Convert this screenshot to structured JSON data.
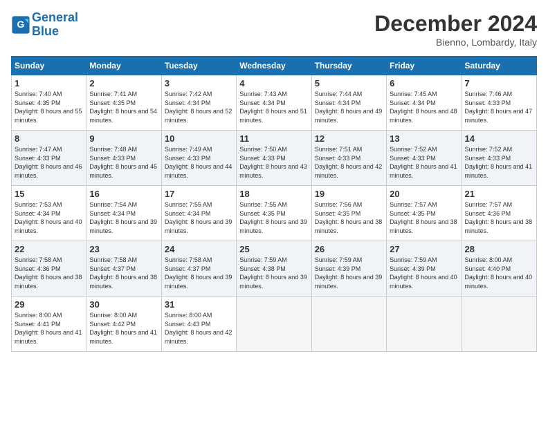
{
  "header": {
    "logo_line1": "General",
    "logo_line2": "Blue",
    "month": "December 2024",
    "location": "Bienno, Lombardy, Italy"
  },
  "days_of_week": [
    "Sunday",
    "Monday",
    "Tuesday",
    "Wednesday",
    "Thursday",
    "Friday",
    "Saturday"
  ],
  "weeks": [
    [
      {
        "day": "1",
        "rise": "7:40 AM",
        "set": "4:35 PM",
        "daylight": "8 hours and 55 minutes."
      },
      {
        "day": "2",
        "rise": "7:41 AM",
        "set": "4:35 PM",
        "daylight": "8 hours and 54 minutes."
      },
      {
        "day": "3",
        "rise": "7:42 AM",
        "set": "4:34 PM",
        "daylight": "8 hours and 52 minutes."
      },
      {
        "day": "4",
        "rise": "7:43 AM",
        "set": "4:34 PM",
        "daylight": "8 hours and 51 minutes."
      },
      {
        "day": "5",
        "rise": "7:44 AM",
        "set": "4:34 PM",
        "daylight": "8 hours and 49 minutes."
      },
      {
        "day": "6",
        "rise": "7:45 AM",
        "set": "4:34 PM",
        "daylight": "8 hours and 48 minutes."
      },
      {
        "day": "7",
        "rise": "7:46 AM",
        "set": "4:33 PM",
        "daylight": "8 hours and 47 minutes."
      }
    ],
    [
      {
        "day": "8",
        "rise": "7:47 AM",
        "set": "4:33 PM",
        "daylight": "8 hours and 46 minutes."
      },
      {
        "day": "9",
        "rise": "7:48 AM",
        "set": "4:33 PM",
        "daylight": "8 hours and 45 minutes."
      },
      {
        "day": "10",
        "rise": "7:49 AM",
        "set": "4:33 PM",
        "daylight": "8 hours and 44 minutes."
      },
      {
        "day": "11",
        "rise": "7:50 AM",
        "set": "4:33 PM",
        "daylight": "8 hours and 43 minutes."
      },
      {
        "day": "12",
        "rise": "7:51 AM",
        "set": "4:33 PM",
        "daylight": "8 hours and 42 minutes."
      },
      {
        "day": "13",
        "rise": "7:52 AM",
        "set": "4:33 PM",
        "daylight": "8 hours and 41 minutes."
      },
      {
        "day": "14",
        "rise": "7:52 AM",
        "set": "4:33 PM",
        "daylight": "8 hours and 41 minutes."
      }
    ],
    [
      {
        "day": "15",
        "rise": "7:53 AM",
        "set": "4:34 PM",
        "daylight": "8 hours and 40 minutes."
      },
      {
        "day": "16",
        "rise": "7:54 AM",
        "set": "4:34 PM",
        "daylight": "8 hours and 39 minutes."
      },
      {
        "day": "17",
        "rise": "7:55 AM",
        "set": "4:34 PM",
        "daylight": "8 hours and 39 minutes."
      },
      {
        "day": "18",
        "rise": "7:55 AM",
        "set": "4:35 PM",
        "daylight": "8 hours and 39 minutes."
      },
      {
        "day": "19",
        "rise": "7:56 AM",
        "set": "4:35 PM",
        "daylight": "8 hours and 38 minutes."
      },
      {
        "day": "20",
        "rise": "7:57 AM",
        "set": "4:35 PM",
        "daylight": "8 hours and 38 minutes."
      },
      {
        "day": "21",
        "rise": "7:57 AM",
        "set": "4:36 PM",
        "daylight": "8 hours and 38 minutes."
      }
    ],
    [
      {
        "day": "22",
        "rise": "7:58 AM",
        "set": "4:36 PM",
        "daylight": "8 hours and 38 minutes."
      },
      {
        "day": "23",
        "rise": "7:58 AM",
        "set": "4:37 PM",
        "daylight": "8 hours and 38 minutes."
      },
      {
        "day": "24",
        "rise": "7:58 AM",
        "set": "4:37 PM",
        "daylight": "8 hours and 39 minutes."
      },
      {
        "day": "25",
        "rise": "7:59 AM",
        "set": "4:38 PM",
        "daylight": "8 hours and 39 minutes."
      },
      {
        "day": "26",
        "rise": "7:59 AM",
        "set": "4:39 PM",
        "daylight": "8 hours and 39 minutes."
      },
      {
        "day": "27",
        "rise": "7:59 AM",
        "set": "4:39 PM",
        "daylight": "8 hours and 40 minutes."
      },
      {
        "day": "28",
        "rise": "8:00 AM",
        "set": "4:40 PM",
        "daylight": "8 hours and 40 minutes."
      }
    ],
    [
      {
        "day": "29",
        "rise": "8:00 AM",
        "set": "4:41 PM",
        "daylight": "8 hours and 41 minutes."
      },
      {
        "day": "30",
        "rise": "8:00 AM",
        "set": "4:42 PM",
        "daylight": "8 hours and 41 minutes."
      },
      {
        "day": "31",
        "rise": "8:00 AM",
        "set": "4:43 PM",
        "daylight": "8 hours and 42 minutes."
      },
      null,
      null,
      null,
      null
    ]
  ]
}
